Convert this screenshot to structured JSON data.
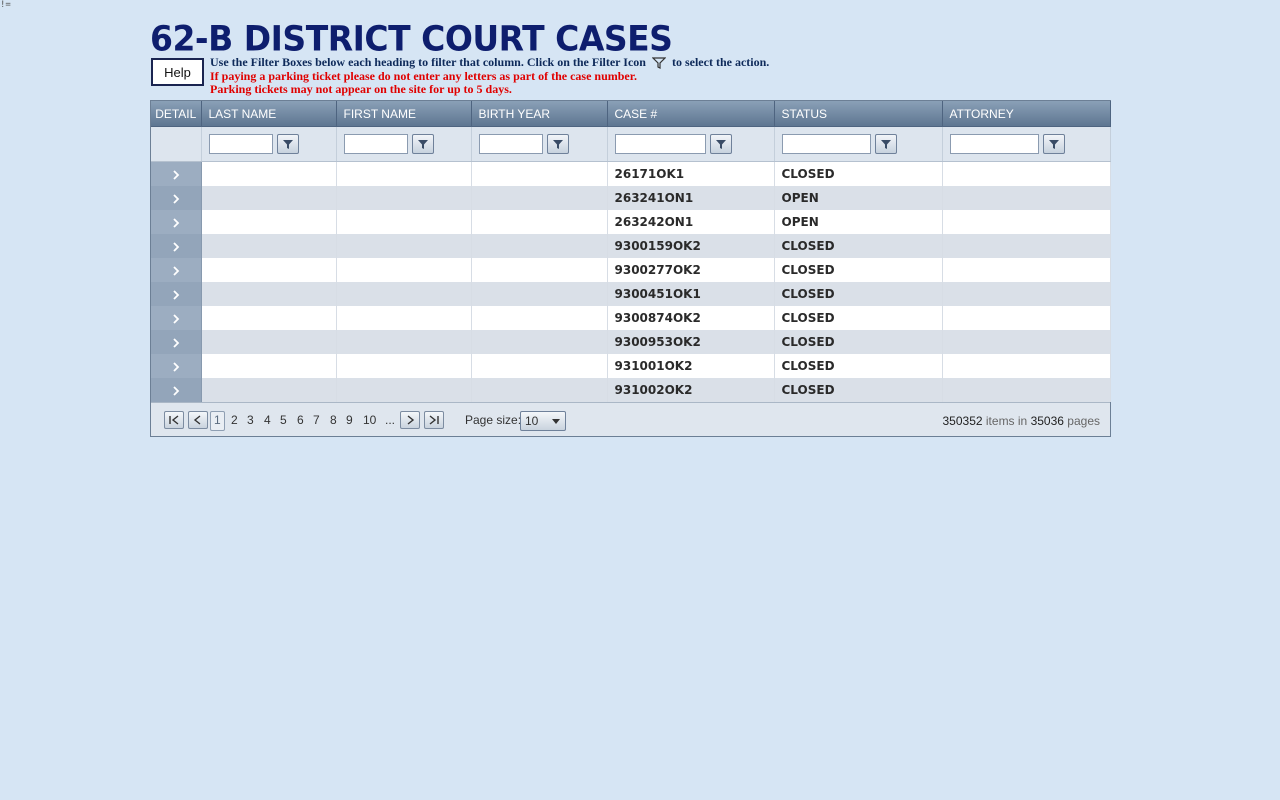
{
  "corner_mark": "!=",
  "title": "62-B DISTRICT COURT CASES",
  "help_label": "Help",
  "instructions": {
    "line1_before": "Use the Filter Boxes below each heading to filter that column.  Click on the Filter Icon",
    "line1_after": "to select the action.",
    "warn1": "If paying a parking ticket please do not enter any letters as part of the case number.",
    "warn2": "Parking tickets may not appear on the site for up to 5 days."
  },
  "columns": [
    "DETAIL",
    "LAST NAME",
    "FIRST NAME",
    "BIRTH YEAR",
    "CASE #",
    "STATUS",
    "ATTORNEY"
  ],
  "rows": [
    {
      "last": "",
      "first": "",
      "birth": "",
      "case": "26171OK1",
      "status": "CLOSED",
      "attorney": ""
    },
    {
      "last": "",
      "first": "",
      "birth": "",
      "case": "263241ON1",
      "status": "OPEN",
      "attorney": ""
    },
    {
      "last": "",
      "first": "",
      "birth": "",
      "case": "263242ON1",
      "status": "OPEN",
      "attorney": ""
    },
    {
      "last": "",
      "first": "",
      "birth": "",
      "case": "9300159OK2",
      "status": "CLOSED",
      "attorney": ""
    },
    {
      "last": "",
      "first": "",
      "birth": "",
      "case": "9300277OK2",
      "status": "CLOSED",
      "attorney": ""
    },
    {
      "last": "",
      "first": "",
      "birth": "",
      "case": "9300451OK1",
      "status": "CLOSED",
      "attorney": ""
    },
    {
      "last": "",
      "first": "",
      "birth": "",
      "case": "9300874OK2",
      "status": "CLOSED",
      "attorney": ""
    },
    {
      "last": "",
      "first": "",
      "birth": "",
      "case": "9300953OK2",
      "status": "CLOSED",
      "attorney": ""
    },
    {
      "last": "",
      "first": "",
      "birth": "",
      "case": "931001OK2",
      "status": "CLOSED",
      "attorney": ""
    },
    {
      "last": "",
      "first": "",
      "birth": "",
      "case": "931002OK2",
      "status": "CLOSED",
      "attorney": ""
    }
  ],
  "pager": {
    "pages": [
      "1",
      "2",
      "3",
      "4",
      "5",
      "6",
      "7",
      "8",
      "9",
      "10",
      "..."
    ],
    "current_page": "1",
    "page_size_label": "Page size:",
    "page_size_value": "10",
    "items_count": "350352",
    "items_text": "items in",
    "pages_count": "35036",
    "pages_text": "pages"
  },
  "icons": {
    "filter": "filter-funnel-icon",
    "detail_expand": "chevron-right-icon",
    "pager_first": "first-page-icon",
    "pager_prev": "prev-page-icon",
    "pager_next": "next-page-icon",
    "pager_last": "last-page-icon"
  },
  "colors": {
    "title": "#0e1e6e",
    "warning_text": "#e00000",
    "header_bg": "#6e86a1",
    "background": "#d6e5f4"
  }
}
